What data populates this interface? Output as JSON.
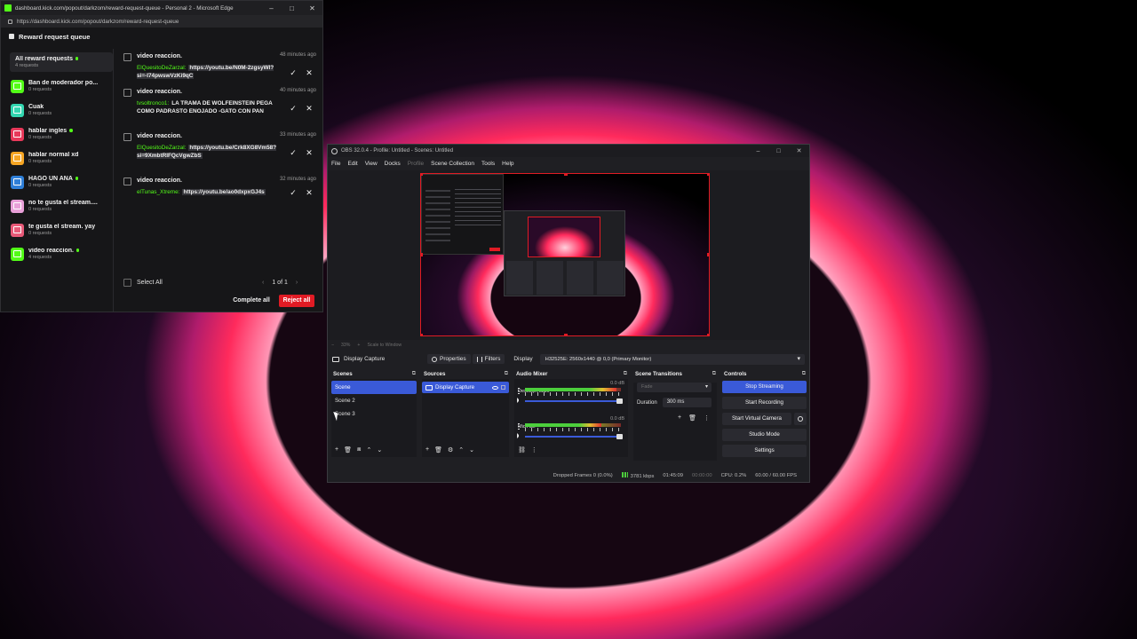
{
  "edge": {
    "window_title": "dashboard.kick.com/popout/darkzom/reward-request-queue - Personal 2 - Microsoft Edge",
    "url": "https://dashboard.kick.com/popout/darkzom/reward-request-queue",
    "header": "Reward request queue",
    "sidebar": [
      {
        "title": "All reward requests",
        "sub": "4 requests",
        "dot": true
      },
      {
        "title": "Ban de moderador po...",
        "sub": "0 requests",
        "color": "#53fc18"
      },
      {
        "title": "Cuak",
        "sub": "0 requests",
        "color": "#33d6b0"
      },
      {
        "title": "hablar ingles",
        "sub": "0 requests",
        "color": "#e8395a",
        "dot": true
      },
      {
        "title": "hablar normal xd",
        "sub": "0 requests",
        "color": "#f5a524"
      },
      {
        "title": "HAGO UN AÑA",
        "sub": "0 requests",
        "color": "#2f7fd8",
        "dot": true
      },
      {
        "title": "no te gusta el stream....",
        "sub": "0 requests",
        "color": "#e8a0d8"
      },
      {
        "title": "te gusta el stream. yay",
        "sub": "0 requests",
        "color": "#e85a78"
      },
      {
        "title": "video reaccion.",
        "sub": "4 requests",
        "color": "#53fc18",
        "dot": true
      }
    ],
    "requests": [
      {
        "title": "video reaccion.",
        "time": "48 minutes ago",
        "user": "ElQuesitoDeZarzal:",
        "message": "https://youtu.be/N0M-2zgsyWI?si=-I74pwswVzKi9qC"
      },
      {
        "title": "video reaccion.",
        "time": "40 minutes ago",
        "user": "tvsoltronco1:",
        "message": "LA TRAMA DE WOLFEINSTEIN PEGA COMO PADRASTO ENOJADO -GATO CON PAN"
      },
      {
        "title": "video reaccion.",
        "time": "33 minutes ago",
        "user": "ElQuesitoDeZarzal:",
        "message": "https://youtu.be/Crk8XG8Vm58?si=9XmbtRIFQcVgwZbS"
      },
      {
        "title": "video reaccion.",
        "time": "32 minutes ago",
        "user": "elTunas_Xtreme:",
        "message": "https://youtu.be/ao0dxpxGJ4s"
      }
    ],
    "footer": {
      "select_all": "Select All",
      "page": "1 of 1",
      "complete_all": "Complete all",
      "reject_all": "Reject all"
    }
  },
  "obs": {
    "window_title": "OBS 32.0.4 - Profile: Untitled - Scenes: Untitled",
    "menu": [
      "File",
      "Edit",
      "View",
      "Docks",
      "Profile",
      "Scene Collection",
      "Tools",
      "Help"
    ],
    "zoom": "33%",
    "scale_mode": "Scale to Window",
    "properties_bar": {
      "source": "Display Capture",
      "properties": "Properties",
      "filters": "Filters",
      "display_label": "Display",
      "display_value": "H32525E: 2560x1440 @ 0,0 (Primary Monitor)"
    },
    "docks": {
      "scenes": "Scenes",
      "sources": "Sources",
      "mixer": "Audio Mixer",
      "transitions": "Scene Transitions",
      "controls": "Controls"
    },
    "scenes": [
      "Scene",
      "Scene 2",
      "Scene 3"
    ],
    "active_scene_index": 0,
    "sources": [
      "Display Capture"
    ],
    "mixer": [
      {
        "name": "Desktop Audio",
        "db": "0.0 dB",
        "level": 0.95
      },
      {
        "name": "Mic/Aux",
        "db": "0.0 dB",
        "level": 0.8
      }
    ],
    "transitions": {
      "type": "Fade",
      "duration_label": "Duration",
      "duration": "300 ms"
    },
    "controls": {
      "stop_streaming": "Stop Streaming",
      "start_recording": "Start Recording",
      "start_virtual_camera": "Start Virtual Camera",
      "studio_mode": "Studio Mode",
      "settings": "Settings"
    },
    "status": {
      "dropped": "Dropped Frames 0 (0.0%)",
      "kbps": "3781 kbps",
      "stream_time": "01:45:09",
      "rec_time": "00:00:00",
      "cpu": "CPU: 0.2%",
      "fps": "60.00 / 60.00 FPS"
    }
  }
}
